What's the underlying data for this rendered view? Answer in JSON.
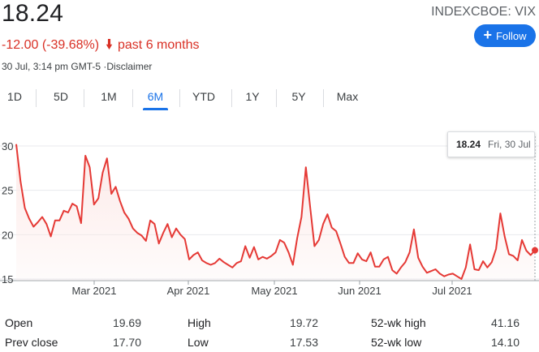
{
  "quote": {
    "price": "18.24",
    "ticker": "INDEXCBOE: VIX",
    "change": "-12.00 (-39.68%)",
    "period": "past 6 months",
    "timestamp": "30 Jul, 3:14 pm GMT-5 ·Disclaimer",
    "follow_label": "Follow"
  },
  "colors": {
    "negative": "#d93025",
    "accent": "#1a73e8",
    "line": "#e53935"
  },
  "tabs": [
    {
      "label": "1D",
      "active": false
    },
    {
      "label": "5D",
      "active": false
    },
    {
      "label": "1M",
      "active": false
    },
    {
      "label": "6M",
      "active": true
    },
    {
      "label": "YTD",
      "active": false
    },
    {
      "label": "1Y",
      "active": false
    },
    {
      "label": "5Y",
      "active": false
    },
    {
      "label": "Max",
      "active": false
    }
  ],
  "tooltip": {
    "value": "18.24",
    "date": "Fri, 30 Jul"
  },
  "chart_data": {
    "type": "area",
    "title": "",
    "xlabel": "",
    "ylabel": "",
    "ylim": [
      15,
      30
    ],
    "y_ticks": [
      "15",
      "20",
      "25",
      "30"
    ],
    "x_ticks": [
      "Mar 2021",
      "Apr 2021",
      "May 2021",
      "Jun 2021",
      "Jul 2021"
    ],
    "grid": "horizontal",
    "series": [
      {
        "values": [
          30.2,
          26.0,
          23.0,
          21.8,
          20.9,
          21.4,
          22.0,
          21.2,
          19.8,
          21.6,
          21.6,
          22.7,
          22.5,
          23.5,
          23.2,
          21.3,
          28.9,
          27.6,
          23.4,
          24.1,
          27.0,
          28.6,
          24.6,
          25.4,
          23.8,
          22.5,
          21.8,
          20.7,
          20.2,
          19.9,
          19.3,
          21.6,
          21.2,
          19.0,
          20.2,
          21.2,
          19.7,
          20.7,
          20.0,
          19.5,
          17.2,
          17.7,
          18.0,
          17.1,
          16.8,
          16.6,
          16.8,
          17.3,
          16.9,
          16.6,
          16.3,
          16.8,
          17.0,
          18.7,
          17.4,
          18.6,
          17.2,
          17.5,
          17.3,
          17.6,
          18.0,
          19.4,
          19.1,
          18.0,
          16.6,
          19.6,
          22.0,
          27.6,
          23.1,
          18.7,
          19.4,
          21.2,
          22.3,
          20.8,
          20.4,
          19.0,
          17.5,
          16.8,
          16.8,
          17.9,
          17.2,
          17.0,
          18.0,
          16.4,
          16.4,
          17.2,
          17.5,
          16.0,
          15.6,
          16.3,
          16.9,
          18.0,
          20.6,
          17.4,
          16.4,
          15.7,
          15.9,
          16.1,
          15.6,
          15.3,
          15.5,
          15.6,
          15.3,
          15.0,
          16.3,
          18.9,
          16.1,
          16.0,
          17.0,
          16.3,
          16.9,
          18.4,
          22.4,
          19.8,
          17.8,
          17.6,
          17.1,
          19.4,
          18.2,
          17.7,
          18.24
        ]
      }
    ]
  },
  "stats": [
    {
      "label": "Open",
      "value": "19.69"
    },
    {
      "label": "Prev close",
      "value": "17.70"
    },
    {
      "label": "High",
      "value": "19.72"
    },
    {
      "label": "Low",
      "value": "17.53"
    },
    {
      "label": "52-wk high",
      "value": "41.16"
    },
    {
      "label": "52-wk low",
      "value": "14.10"
    }
  ]
}
